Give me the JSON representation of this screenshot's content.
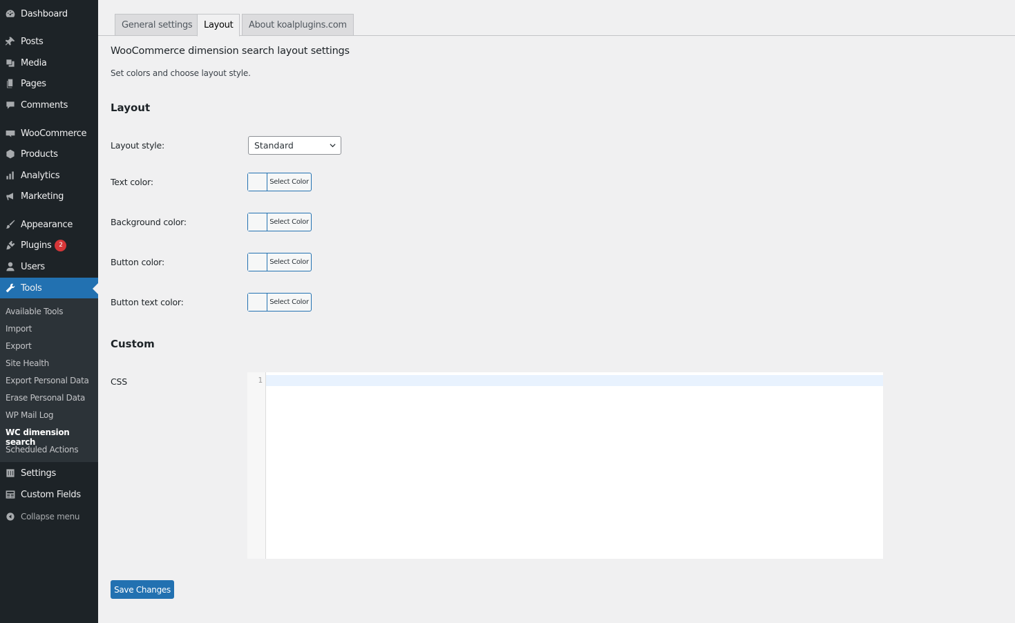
{
  "sidebar": {
    "items": [
      {
        "label": "Dashboard",
        "icon": "dashboard-icon"
      },
      {
        "label": "Posts",
        "icon": "pin-icon"
      },
      {
        "label": "Media",
        "icon": "media-icon"
      },
      {
        "label": "Pages",
        "icon": "pages-icon"
      },
      {
        "label": "Comments",
        "icon": "comment-icon"
      },
      {
        "label": "WooCommerce",
        "icon": "woo-icon"
      },
      {
        "label": "Products",
        "icon": "box-icon"
      },
      {
        "label": "Analytics",
        "icon": "bar-chart-icon"
      },
      {
        "label": "Marketing",
        "icon": "megaphone-icon"
      },
      {
        "label": "Appearance",
        "icon": "brush-icon"
      },
      {
        "label": "Plugins",
        "icon": "plug-icon",
        "badge": "2"
      },
      {
        "label": "Users",
        "icon": "user-icon"
      },
      {
        "label": "Tools",
        "icon": "wrench-icon",
        "active": true
      },
      {
        "label": "Settings",
        "icon": "sliders-icon"
      },
      {
        "label": "Custom Fields",
        "icon": "table-icon"
      }
    ],
    "submenu": [
      "Available Tools",
      "Import",
      "Export",
      "Site Health",
      "Export Personal Data",
      "Erase Personal Data",
      "WP Mail Log",
      "WC dimension search",
      "Scheduled Actions"
    ],
    "submenu_current": "WC dimension search",
    "collapse_label": "Collapse menu"
  },
  "tabs": [
    {
      "label": "General settings",
      "active": false
    },
    {
      "label": "Layout",
      "active": true
    },
    {
      "label": "About koalplugins.com",
      "active": false
    }
  ],
  "page": {
    "title": "WooCommerce dimension search layout settings",
    "description": "Set colors and choose layout style."
  },
  "layout_section": {
    "heading": "Layout",
    "layout_style_label": "Layout style:",
    "layout_style_value": "Standard",
    "text_color_label": "Text color:",
    "background_color_label": "Background color:",
    "button_color_label": "Button color:",
    "button_text_color_label": "Button text color:",
    "select_color_label": "Select Color"
  },
  "custom_section": {
    "heading": "Custom",
    "css_label": "CSS",
    "line_number": "1"
  },
  "save_label": "Save Changes",
  "colors": {
    "sidebar_bg": "#1d2327",
    "accent": "#2271b1",
    "badge": "#d63638"
  }
}
